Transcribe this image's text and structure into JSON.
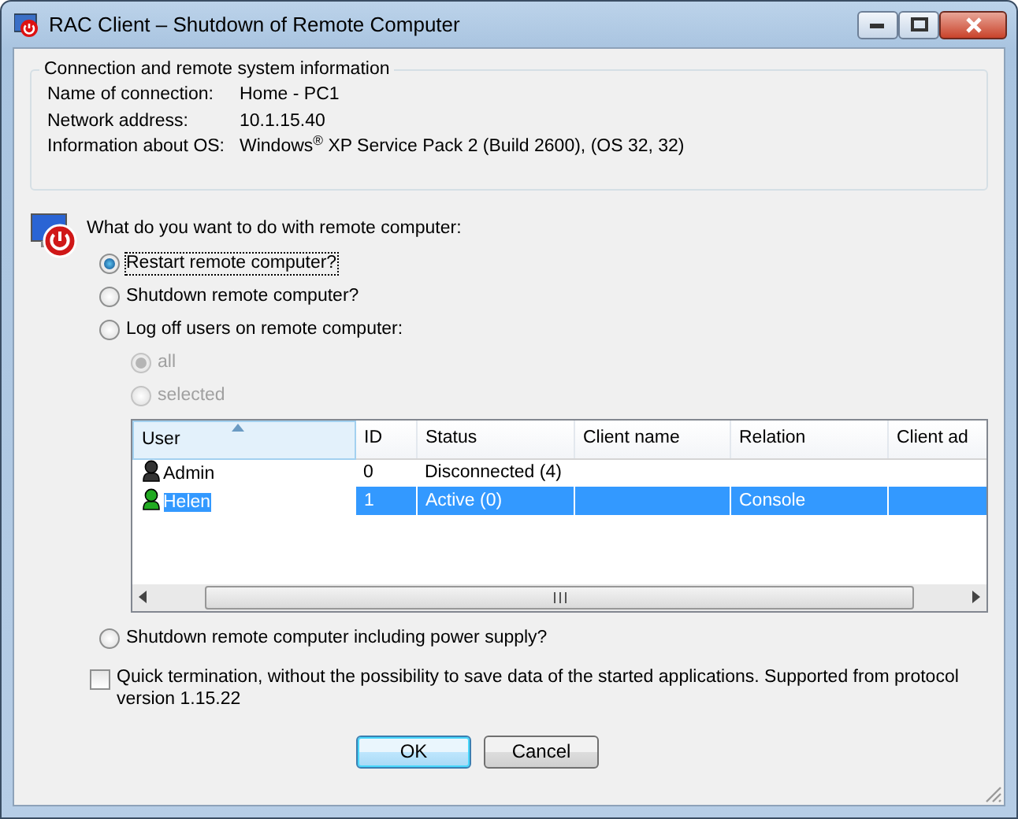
{
  "window": {
    "title": "RAC Client – Shutdown of Remote Computer"
  },
  "connection_info": {
    "title": "Connection and remote system information",
    "rows": [
      {
        "label": "Name of connection:",
        "value": "Home - PC1"
      },
      {
        "label": "Network address:",
        "value": "10.1.15.40"
      },
      {
        "label": "Information about OS:",
        "value": "Windows$^{®}$ XP Service Pack 2 (Build 2600), (OS 32, 32)"
      }
    ]
  },
  "question": "What do you want to do with remote computer:",
  "options": [
    {
      "label": "Restart remote computer?",
      "selected": true,
      "focused": true
    },
    {
      "label": "Shutdown remote computer?",
      "selected": false,
      "focused": false
    },
    {
      "label": "Log off users on remote computer:",
      "selected": false,
      "focused": false,
      "scope_options": [
        {
          "label": "all",
          "selected": true,
          "disabled": true
        },
        {
          "label": "selected",
          "selected": false,
          "disabled": true
        }
      ],
      "users_table": {
        "columns": [
          {
            "label": "User",
            "sorted": true
          },
          {
            "label": "ID",
            "sorted": false
          },
          {
            "label": "Status",
            "sorted": false
          },
          {
            "label": "Client name",
            "sorted": false
          },
          {
            "label": "Relation",
            "sorted": false
          },
          {
            "label": "Client ad",
            "sorted": false
          }
        ],
        "rows": [
          {
            "color": "#333333",
            "selected": false,
            "cells": [
              "Admin",
              "0",
              "Disconnected (4)",
              "",
              "",
              ""
            ]
          },
          {
            "color": "#22aa22",
            "selected": true,
            "cells": [
              "Helen",
              "1",
              "Active (0)",
              "",
              "Console",
              ""
            ]
          }
        ]
      }
    },
    {
      "label": "Shutdown remote computer including power supply?",
      "selected": false,
      "focused": false
    }
  ],
  "quick_termination": {
    "label": "Quick termination, without the possibility to save data of the started applications. Supported from protocol version 1.15.22",
    "checked": false
  },
  "buttons": [
    {
      "label": "OK",
      "default": true
    },
    {
      "label": "Cancel",
      "default": false
    }
  ]
}
